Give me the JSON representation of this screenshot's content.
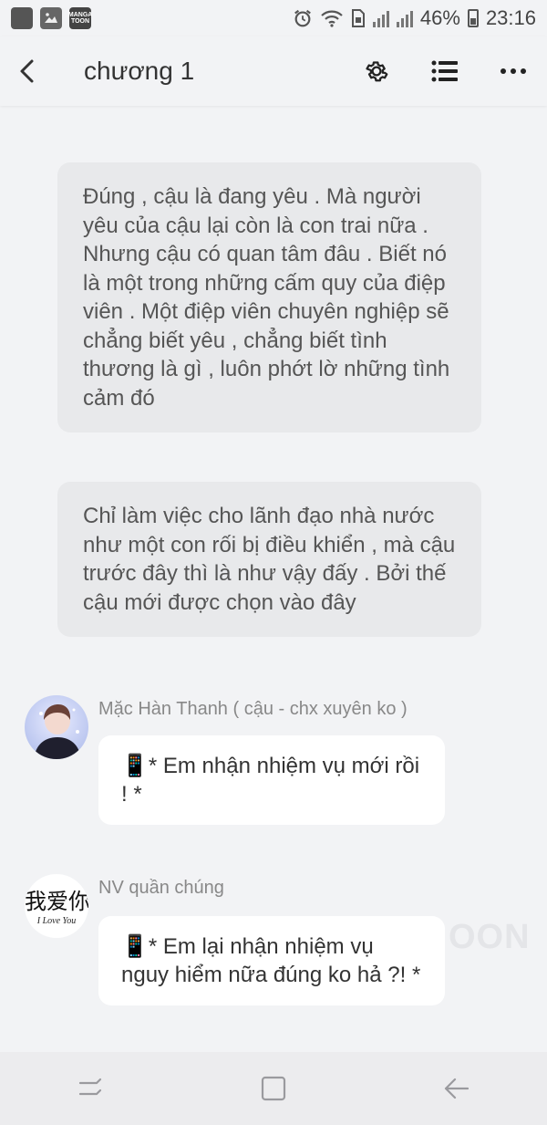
{
  "status_bar": {
    "battery_pct": "46%",
    "time": "23:16",
    "manga_icon_label": "MANGA TOON"
  },
  "header": {
    "title": "chương 1"
  },
  "narrations": [
    {
      "text": "Đúng , cậu là đang yêu . Mà người yêu của cậu lại còn là con trai nữa . Nhưng cậu có quan tâm đâu . Biết nó là một trong những cấm quy của điệp viên . Một điệp viên chuyên nghiệp sẽ chẳng biết yêu , chẳng biết tình thương là gì , luôn phớt lờ những tình cảm đó"
    },
    {
      "text": "Chỉ làm việc cho lãnh đạo nhà nước như một con rối bị điều khiển , mà cậu trước đây thì là như vậy đấy . Bởi thế cậu mới được chọn vào đây"
    }
  ],
  "messages": [
    {
      "sender": "Mặc Hàn Thanh ( cậu - chx xuyên ko )",
      "text": "📱* Em nhận nhiệm vụ mới rồi ! *"
    },
    {
      "sender": "NV quần chúng",
      "text": "📱* Em lại nhận nhiệm vụ nguy hiểm nữa đúng ko hả ?! *",
      "avatar_text": "我爱你",
      "avatar_subtext": "I Love You"
    }
  ],
  "watermark": "OON",
  "colors": {
    "background": "#f2f3f5",
    "narration_bg": "#e8e9eb",
    "bubble_bg": "#ffffff",
    "sender_text": "#888888"
  }
}
